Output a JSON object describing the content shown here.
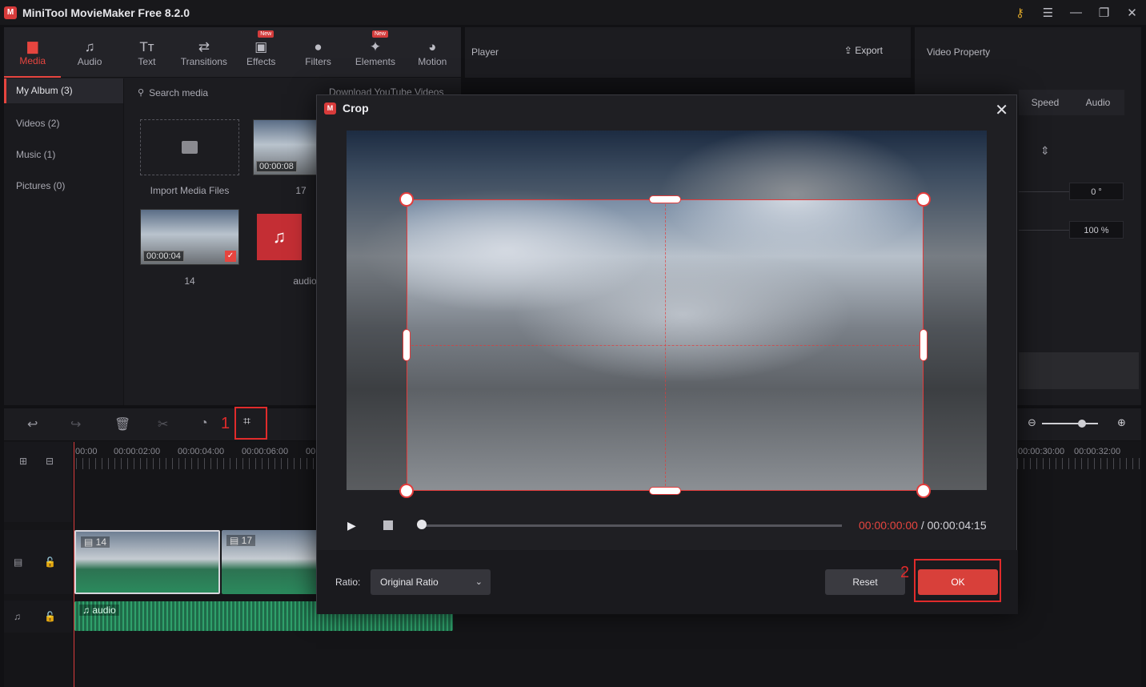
{
  "app": {
    "title": "MiniTool MovieMaker Free 8.2.0",
    "logo_text": "M"
  },
  "window_controls": [
    "key-icon",
    "menu-icon",
    "minimize-icon",
    "restore-icon",
    "close-icon"
  ],
  "toolbar": [
    {
      "label": "Media",
      "icon": "folder-icon",
      "active": true
    },
    {
      "label": "Audio",
      "icon": "music-note-icon"
    },
    {
      "label": "Text",
      "icon": "text-icon"
    },
    {
      "label": "Transitions",
      "icon": "transitions-icon"
    },
    {
      "label": "Effects",
      "icon": "effects-icon",
      "badge": "New"
    },
    {
      "label": "Filters",
      "icon": "filters-icon"
    },
    {
      "label": "Elements",
      "icon": "elements-icon",
      "badge": "New"
    },
    {
      "label": "Motion",
      "icon": "motion-icon"
    }
  ],
  "sidebar": [
    {
      "label": "My Album (3)",
      "active": true
    },
    {
      "label": "Videos (2)"
    },
    {
      "label": "Music (1)"
    },
    {
      "label": "Pictures (0)"
    }
  ],
  "media": {
    "search_placeholder": "Search media",
    "download_link": "Download YouTube Videos",
    "import_label": "Import Media Files",
    "items": [
      {
        "caption": "17",
        "duration": "00:00:08"
      },
      {
        "caption": "14",
        "duration": "00:00:04"
      },
      {
        "caption": "audio"
      }
    ]
  },
  "player": {
    "label": "Player",
    "export_label": "Export"
  },
  "property": {
    "label": "Video Property",
    "tabs": [
      "Speed",
      "Audio"
    ],
    "rotation_value": "0 °",
    "scale_value": "100 %"
  },
  "timeline": {
    "ruler": [
      "00:00",
      "00:00:02:00",
      "00:00:04:00",
      "00:00:06:00",
      "00",
      "00:00:30:00",
      "00:00:32:00"
    ],
    "marker1": "1",
    "clips": [
      {
        "label": "14"
      },
      {
        "label": "17"
      }
    ],
    "audio_label": "audio"
  },
  "crop": {
    "title": "Crop",
    "time_current": "00:00:00:00",
    "time_separator": " / ",
    "time_total": "00:00:04:15",
    "ratio_label": "Ratio:",
    "ratio_value": "Original Ratio",
    "reset_label": "Reset",
    "ok_label": "OK",
    "marker2": "2"
  },
  "colors": {
    "accent": "#e6453f",
    "highlight": "#e02b2b",
    "audio": "#2fa06b"
  }
}
